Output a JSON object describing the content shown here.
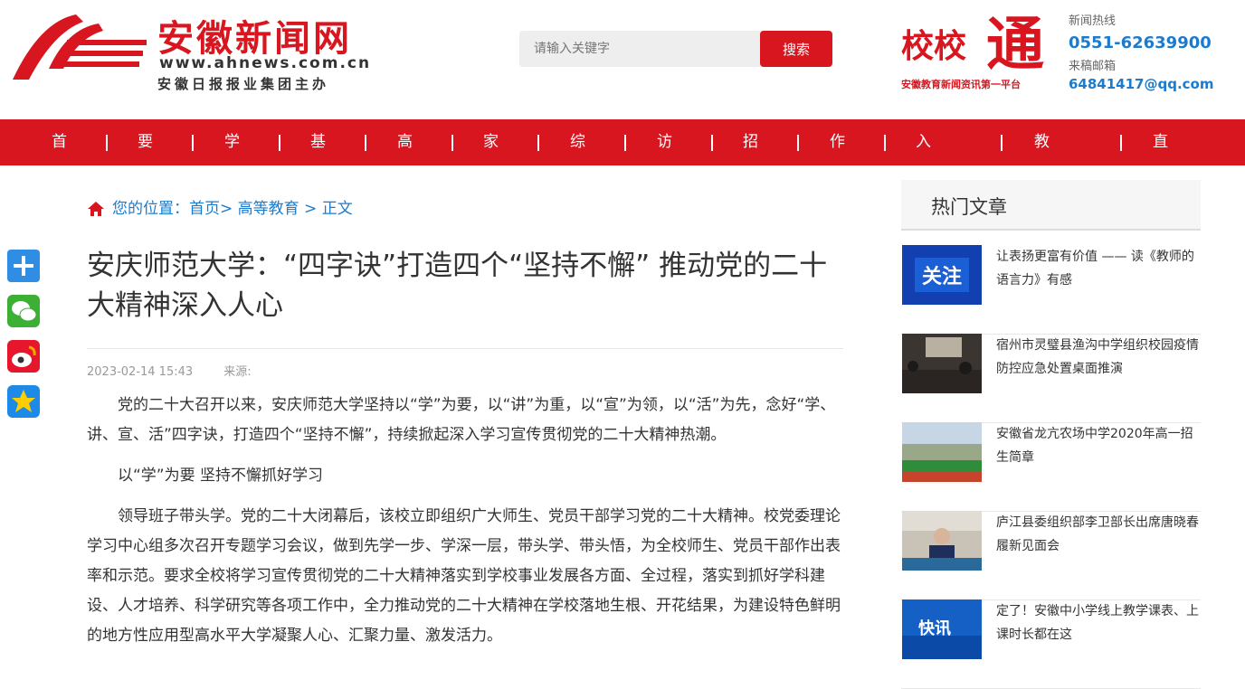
{
  "header": {
    "logo_title": "安徽新闻网",
    "logo_url": "www.ahnews.com.cn",
    "logo_sub": "安徽日报报业集团主办",
    "search_placeholder": "请输入关键字",
    "search_button": "搜索",
    "brand_small": "校校",
    "brand_big": "通",
    "brand_slogan": "安徽教育新闻资讯第一平台",
    "hotline_label": "新闻热线",
    "hotline": "0551-62639900",
    "email_label": "来稿邮箱",
    "email": "64841417@qq.com"
  },
  "nav": [
    "首页",
    "要闻",
    "学前",
    "基教",
    "高教",
    "家教",
    "综合",
    "访谈",
    "招考",
    "作品",
    "入驻学校",
    "教育视界",
    "直播"
  ],
  "breadcrumb": "您的位置：首页> 高等教育 > 正文",
  "article": {
    "title": "安庆师范大学：“四字诀”打造四个“坚持不懈” 推动党的二十大精神深入人心",
    "date": "2023-02-14 15:43",
    "source": "来源:",
    "paragraphs": [
      "党的二十大召开以来，安庆师范大学坚持以“学”为要，以“讲”为重，以“宣”为领，以“活”为先，念好“学、讲、宣、活”四字诀，打造四个“坚持不懈”，持续掀起深入学习宣传贯彻党的二十大精神热潮。",
      "以“学”为要 坚持不懈抓好学习",
      "领导班子带头学。党的二十大闭幕后，该校立即组织广大师生、党员干部学习党的二十大精神。校党委理论学习中心组多次召开专题学习会议，做到先学一步、学深一层，带头学、带头悟，为全校师生、党员干部作出表率和示范。要求全校将学习宣传贯彻党的二十大精神落实到学校事业发展各方面、全过程，落实到抓好学科建设、人才培养、科学研究等各项工作中，全力推动党的二十大精神在学校落地生根、开花结果，为建设特色鲜明的地方性应用型高水平大学凝聚人心、汇聚力量、激发活力。"
    ]
  },
  "sidebar": {
    "title": "热门文章",
    "articles": [
      {
        "title": "让表扬更富有价值 —— 读《教师的语言力》有感",
        "thumb_text": "关注"
      },
      {
        "title": "宿州市灵璧县渔沟中学组织校园疫情防控应急处置桌面推演",
        "thumb_text": ""
      },
      {
        "title": "安徽省龙亢农场中学2020年高一招生简章",
        "thumb_text": ""
      },
      {
        "title": "庐江县委组织部李卫部长出席唐晓春履新见面会",
        "thumb_text": ""
      },
      {
        "title": "定了！安徽中小学线上教学课表、上课时长都在这",
        "thumb_text": "快讯"
      }
    ]
  },
  "colors": {
    "brand_red": "#d7161f",
    "link_blue": "#1b7bcf"
  },
  "share_icons": [
    "plus-share-icon",
    "wechat-icon",
    "weibo-icon",
    "qzone-icon"
  ]
}
